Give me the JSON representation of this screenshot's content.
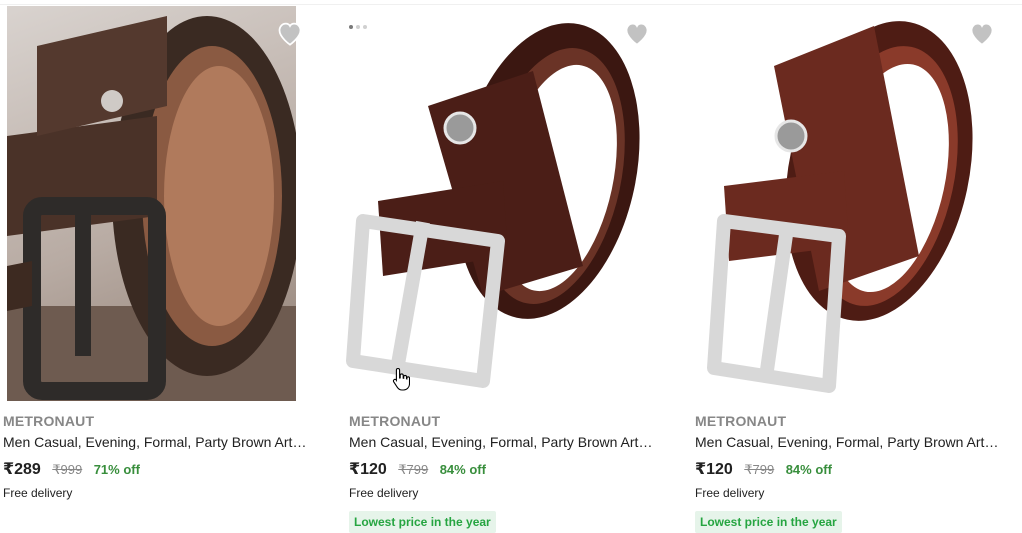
{
  "products": [
    {
      "brand": "METRONAUT",
      "title": "Men Casual, Evening, Formal, Party Brown Artificial Leather Belt",
      "price": "₹289",
      "mrp": "₹999",
      "discount": "71% off",
      "delivery": "Free delivery",
      "badge": "",
      "image_icon": "belt-image",
      "wishlist_icon": "heart-icon",
      "belt_color": "#4a3228",
      "buckle_color": "#2e2b29"
    },
    {
      "brand": "METRONAUT",
      "title": "Men Casual, Evening, Formal, Party Brown Artificial Leather Belt",
      "price": "₹120",
      "mrp": "₹799",
      "discount": "84% off",
      "delivery": "Free delivery",
      "badge": "Lowest price in the year",
      "image_icon": "belt-image",
      "wishlist_icon": "heart-icon",
      "belt_color": "#4b1e17",
      "buckle_color": "#d8d8d8"
    },
    {
      "brand": "METRONAUT",
      "title": "Men Casual, Evening, Formal, Party Brown Artificial Leather Belt",
      "price": "₹120",
      "mrp": "₹799",
      "discount": "84% off",
      "delivery": "Free delivery",
      "badge": "Lowest price in the year",
      "image_icon": "belt-image",
      "wishlist_icon": "heart-icon",
      "belt_color": "#6b2a1f",
      "buckle_color": "#d8d8d8"
    }
  ],
  "colors": {
    "discount_green": "#388e3c",
    "badge_bg": "#e6f4ea",
    "badge_text": "#26a541",
    "brand_gray": "#878787",
    "heart_gray": "#c2c2c2"
  }
}
